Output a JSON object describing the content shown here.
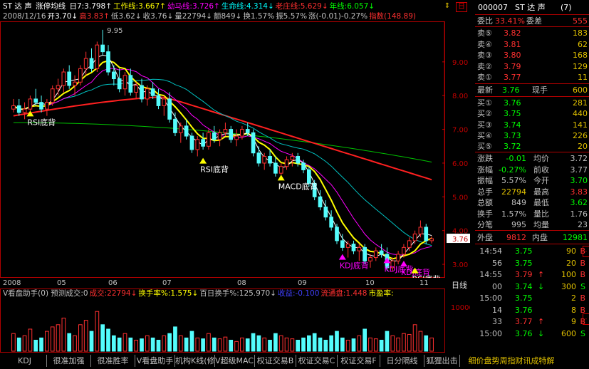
{
  "header": {
    "name": "ST 达 声",
    "indicator": "涨停均线",
    "params": [
      {
        "t": "日7:3.798↑",
        "c": "#ffffff"
      },
      {
        "t": "工作线:3.667↑",
        "c": "#ffff00"
      },
      {
        "t": "幼马线:3.726↑",
        "c": "#ff00ff"
      },
      {
        "t": "生命线:4.314↓",
        "c": "#00ffff"
      },
      {
        "t": "老庄线:5.629↓",
        "c": "#ff3030"
      },
      {
        "t": "年线:6.057↓",
        "c": "#00ff00"
      }
    ],
    "line2": [
      {
        "t": "2008/12/16",
        "c": "#c0c0c0"
      },
      {
        "t": "开3.70↓",
        "c": "#ffffff"
      },
      {
        "t": "高3.83↑",
        "c": "#ff3030"
      },
      {
        "t": "低3.62↓",
        "c": "#c0c0c0"
      },
      {
        "t": "收3.76↓",
        "c": "#c0c0c0"
      },
      {
        "t": "量22794↓",
        "c": "#c0c0c0"
      },
      {
        "t": "额849↓",
        "c": "#c0c0c0"
      },
      {
        "t": "换1.57%",
        "c": "#c0c0c0"
      },
      {
        "t": "振5.57%",
        "c": "#c0c0c0"
      },
      {
        "t": "涨(-0.01)-0.27%",
        "c": "#c0c0c0"
      },
      {
        "t": "指数(148.89)",
        "c": "#ff3030"
      }
    ]
  },
  "chart_data": {
    "type": "candlestick",
    "price_axis": [
      "9.00",
      "8.00",
      "7.00",
      "6.00",
      "5.00",
      "4.00",
      "3.00"
    ],
    "price_range": [
      2.6,
      10.2
    ],
    "high_label": "9.95",
    "last_label": "3.76",
    "x_labels": [
      "2008",
      "05",
      "06",
      "07",
      "08",
      "09",
      "10",
      "11"
    ],
    "candles": [
      [
        7.6,
        7.9,
        7.5,
        7.7
      ],
      [
        7.7,
        7.9,
        7.4,
        7.5
      ],
      [
        7.5,
        7.8,
        7.3,
        7.6
      ],
      [
        7.6,
        8.0,
        7.5,
        7.9
      ],
      [
        7.9,
        8.2,
        7.7,
        7.8
      ],
      [
        7.8,
        8.0,
        7.5,
        7.6
      ],
      [
        7.6,
        7.9,
        7.4,
        7.8
      ],
      [
        7.8,
        8.3,
        7.7,
        8.2
      ],
      [
        8.2,
        8.5,
        8.0,
        8.3
      ],
      [
        8.3,
        8.8,
        8.1,
        8.7
      ],
      [
        8.7,
        8.9,
        8.2,
        8.3
      ],
      [
        8.3,
        8.6,
        8.0,
        8.4
      ],
      [
        8.4,
        8.9,
        8.3,
        8.8
      ],
      [
        8.8,
        9.3,
        8.6,
        9.1
      ],
      [
        9.1,
        9.4,
        8.7,
        8.8
      ],
      [
        8.8,
        9.6,
        8.7,
        9.5
      ],
      [
        9.5,
        9.95,
        9.2,
        9.3
      ],
      [
        9.3,
        9.5,
        8.6,
        8.7
      ],
      [
        8.7,
        8.9,
        8.3,
        8.5
      ],
      [
        8.5,
        8.8,
        8.1,
        8.2
      ],
      [
        8.2,
        8.7,
        8.0,
        8.6
      ],
      [
        8.6,
        8.8,
        8.0,
        8.1
      ],
      [
        8.1,
        8.4,
        7.9,
        8.3
      ],
      [
        8.3,
        8.5,
        7.8,
        7.9
      ],
      [
        7.9,
        8.3,
        7.7,
        8.2
      ],
      [
        8.2,
        8.4,
        7.9,
        8.0
      ],
      [
        8.0,
        8.2,
        7.6,
        7.7
      ],
      [
        7.7,
        8.0,
        7.4,
        7.9
      ],
      [
        7.9,
        8.1,
        7.2,
        7.3
      ],
      [
        7.3,
        7.5,
        6.8,
        6.9
      ],
      [
        6.9,
        7.2,
        6.6,
        7.1
      ],
      [
        7.1,
        7.3,
        6.7,
        6.8
      ],
      [
        6.8,
        6.9,
        6.3,
        6.4
      ],
      [
        6.4,
        6.8,
        6.2,
        6.7
      ],
      [
        6.7,
        6.9,
        6.4,
        6.5
      ],
      [
        6.5,
        7.0,
        6.4,
        6.9
      ],
      [
        6.9,
        7.1,
        6.6,
        6.7
      ],
      [
        6.7,
        7.0,
        6.5,
        6.9
      ],
      [
        6.9,
        7.2,
        6.8,
        7.0
      ],
      [
        7.0,
        7.1,
        6.6,
        6.7
      ],
      [
        6.7,
        7.0,
        6.5,
        6.8
      ],
      [
        6.8,
        7.1,
        6.7,
        7.0
      ],
      [
        7.0,
        7.2,
        6.8,
        6.9
      ],
      [
        6.9,
        7.0,
        6.2,
        6.3
      ],
      [
        6.3,
        6.5,
        5.9,
        6.0
      ],
      [
        6.0,
        6.3,
        5.8,
        6.2
      ],
      [
        6.2,
        6.4,
        5.9,
        6.0
      ],
      [
        6.0,
        6.2,
        5.6,
        5.7
      ],
      [
        5.7,
        6.0,
        5.5,
        5.9
      ],
      [
        5.9,
        6.2,
        5.8,
        6.1
      ],
      [
        6.1,
        6.3,
        5.9,
        6.2
      ],
      [
        6.2,
        6.3,
        5.9,
        6.0
      ],
      [
        6.0,
        6.1,
        5.7,
        5.8
      ],
      [
        5.8,
        5.9,
        5.3,
        5.4
      ],
      [
        5.4,
        5.5,
        4.9,
        5.0
      ],
      [
        5.0,
        5.2,
        4.6,
        4.7
      ],
      [
        4.7,
        4.9,
        4.3,
        4.4
      ],
      [
        4.4,
        4.6,
        4.0,
        4.1
      ],
      [
        4.1,
        4.2,
        3.6,
        3.7
      ],
      [
        3.7,
        3.9,
        3.4,
        3.5
      ],
      [
        3.5,
        3.7,
        3.2,
        3.6
      ],
      [
        3.6,
        3.7,
        3.3,
        3.4
      ],
      [
        3.4,
        3.6,
        3.1,
        3.5
      ],
      [
        3.5,
        3.6,
        3.0,
        3.1
      ],
      [
        3.1,
        3.3,
        2.9,
        3.2
      ],
      [
        3.2,
        3.5,
        3.1,
        3.4
      ],
      [
        3.4,
        3.6,
        3.2,
        3.3
      ],
      [
        3.3,
        3.5,
        2.8,
        2.9
      ],
      [
        2.9,
        3.2,
        2.8,
        3.1
      ],
      [
        3.1,
        3.4,
        3.0,
        3.3
      ],
      [
        3.3,
        3.6,
        3.2,
        3.5
      ],
      [
        3.5,
        3.8,
        3.4,
        3.7
      ],
      [
        3.7,
        4.0,
        3.6,
        3.9
      ],
      [
        3.9,
        4.3,
        3.8,
        4.1
      ],
      [
        4.1,
        4.2,
        3.6,
        3.7
      ],
      [
        3.7,
        3.83,
        3.62,
        3.76
      ]
    ],
    "annotations": [
      {
        "text": "RSI底背",
        "c": "#ffffff",
        "i": 3,
        "p": 7.3
      },
      {
        "text": "RSI底背",
        "c": "#ffffff",
        "i": 34,
        "p": 5.9
      },
      {
        "text": "MACD底背",
        "c": "#ffffff",
        "i": 48,
        "p": 5.4
      },
      {
        "text": "KDJ底背",
        "c": "#ff00ff",
        "i": 59,
        "p": 3.05
      },
      {
        "text": "KDJ底背",
        "c": "#ff00ff",
        "i": 67,
        "p": 2.95
      },
      {
        "text": "KDJ底背",
        "c": "#ff00ff",
        "i": 70,
        "p": 2.85
      },
      {
        "text": "RSI底背",
        "c": "#ffffff",
        "i": 72,
        "p": 2.65
      }
    ],
    "volume": [
      40,
      30,
      35,
      50,
      25,
      30,
      45,
      55,
      60,
      75,
      40,
      35,
      60,
      70,
      45,
      90,
      60,
      50,
      35,
      30,
      40,
      30,
      25,
      28,
      35,
      30,
      25,
      35,
      40,
      55,
      35,
      30,
      45,
      30,
      28,
      40,
      30,
      28,
      32,
      25,
      22,
      30,
      28,
      40,
      35,
      30,
      25,
      40,
      35,
      30,
      28,
      25,
      30,
      35,
      40,
      30,
      25,
      35,
      45,
      30,
      25,
      28,
      35,
      50,
      30,
      28,
      25,
      45,
      35,
      30,
      40,
      38,
      60,
      45,
      35,
      30
    ],
    "volume_axis": "100000"
  },
  "volume_header": [
    {
      "t": "V看盘助手(0) 预测成交:0",
      "c": "#c0c0c0"
    },
    {
      "t": "成交:22794↓",
      "c": "#ff3030"
    },
    {
      "t": "换手率%:1.575↓",
      "c": "#ffff00"
    },
    {
      "t": "百日换手%:125.970↓",
      "c": "#c0c0c0"
    },
    {
      "t": "收益:-0.100",
      "c": "#4040ff"
    },
    {
      "t": "流通盘:1.448",
      "c": "#ff3030"
    },
    {
      "t": "市盈率:",
      "c": "#ffff00"
    }
  ],
  "period_label": "日线",
  "right_panel": {
    "code": "000007",
    "name": "ST 达 声",
    "suffix": "(7)",
    "weibi_label": "委比",
    "weibi_val": "33.41%",
    "weicha_label": "委差",
    "weicha_val": "555",
    "sells": [
      {
        "l": "卖⑤",
        "p": "3.82",
        "v": "183"
      },
      {
        "l": "卖④",
        "p": "3.81",
        "v": "62"
      },
      {
        "l": "卖③",
        "p": "3.80",
        "v": "168"
      },
      {
        "l": "卖②",
        "p": "3.79",
        "v": "129"
      },
      {
        "l": "卖①",
        "p": "3.77",
        "v": "11"
      }
    ],
    "latest": {
      "l": "最新",
      "p": "3.76",
      "l2": "现手",
      "v": "600"
    },
    "buys": [
      {
        "l": "买①",
        "p": "3.76",
        "v": "281"
      },
      {
        "l": "买②",
        "p": "3.75",
        "v": "440"
      },
      {
        "l": "买③",
        "p": "3.74",
        "v": "141"
      },
      {
        "l": "买④",
        "p": "3.73",
        "v": "226"
      },
      {
        "l": "买⑤",
        "p": "3.72",
        "v": "20"
      }
    ],
    "stats": [
      {
        "a": "涨跌",
        "b": "-0.01",
        "c": "均价",
        "d": "3.72",
        "bc": "#00ff00",
        "dc": "#c0c0c0"
      },
      {
        "a": "涨幅",
        "b": "-0.27%",
        "c": "前收",
        "d": "3.77",
        "bc": "#00ff00",
        "dc": "#c0c0c0"
      },
      {
        "a": "振幅",
        "b": "5.57%",
        "c": "今开",
        "d": "3.70",
        "bc": "#c0c0c0",
        "dc": "#00ff00"
      },
      {
        "a": "总手",
        "b": "22794",
        "c": "最高",
        "d": "3.83",
        "bc": "#e0c000",
        "dc": "#ff3030"
      },
      {
        "a": "总额",
        "b": "849",
        "c": "最低",
        "d": "3.62",
        "bc": "#c0c0c0",
        "dc": "#00ff00"
      },
      {
        "a": "换手",
        "b": "1.57%",
        "c": "量比",
        "d": "1.76",
        "bc": "#c0c0c0",
        "dc": "#c0c0c0"
      },
      {
        "a": "分笔",
        "b": "995",
        "c": "均量",
        "d": "23",
        "bc": "#c0c0c0",
        "dc": "#c0c0c0"
      }
    ],
    "waipan": {
      "l": "外盘",
      "v": "9812",
      "l2": "内盘",
      "v2": "12981"
    },
    "ticks": [
      {
        "t": "14:54",
        "p": "3.75",
        "a": "",
        "v": "90",
        "s": "B",
        "pc": "#00ff00",
        "sc": "#ff3030"
      },
      {
        "t": "56",
        "p": "3.75",
        "a": "",
        "v": "20",
        "s": "B",
        "pc": "#00ff00",
        "sc": "#ff3030"
      },
      {
        "t": "14:55",
        "p": "3.79",
        "a": "↑",
        "v": "100",
        "s": "B",
        "pc": "#ff3030",
        "sc": "#ff3030"
      },
      {
        "t": "00",
        "p": "3.74",
        "a": "↓",
        "v": "300",
        "s": "S",
        "pc": "#00ff00",
        "sc": "#00ff00"
      },
      {
        "t": "15:00",
        "p": "3.75",
        "a": "",
        "v": "2",
        "s": "B",
        "pc": "#00ff00",
        "sc": "#ff3030"
      },
      {
        "t": "14",
        "p": "3.76",
        "a": "",
        "v": "8",
        "s": "B",
        "pc": "#00ff00",
        "sc": "#ff3030"
      },
      {
        "t": "33",
        "p": "3.77",
        "a": "↑",
        "v": "9",
        "s": "B",
        "pc": "#ff3030",
        "sc": "#ff3030"
      },
      {
        "t": "15:00",
        "p": "3.76",
        "a": "↓",
        "v": "600",
        "s": "S",
        "pc": "#00ff00",
        "sc": "#00ff00"
      }
    ]
  },
  "tabs": [
    {
      "label": "KDJ",
      "w": 62
    },
    {
      "label": "很准加强",
      "w": 62
    },
    {
      "label": "很准胜率",
      "w": 62
    },
    {
      "label": "V看盘助手",
      "w": 56
    },
    {
      "label": "机构K线(修",
      "w": 56
    },
    {
      "label": "V超级MACD",
      "w": 56
    },
    {
      "label": "权证交易B",
      "w": 58
    },
    {
      "label": "权证交易C",
      "w": 58
    },
    {
      "label": "权证交易F",
      "w": 60
    },
    {
      "label": "日分隔线",
      "w": 62
    },
    {
      "label": "狐狸出击",
      "w": 50
    },
    {
      "label": "细价盘势周指财讯成特解",
      "w": 145
    }
  ]
}
